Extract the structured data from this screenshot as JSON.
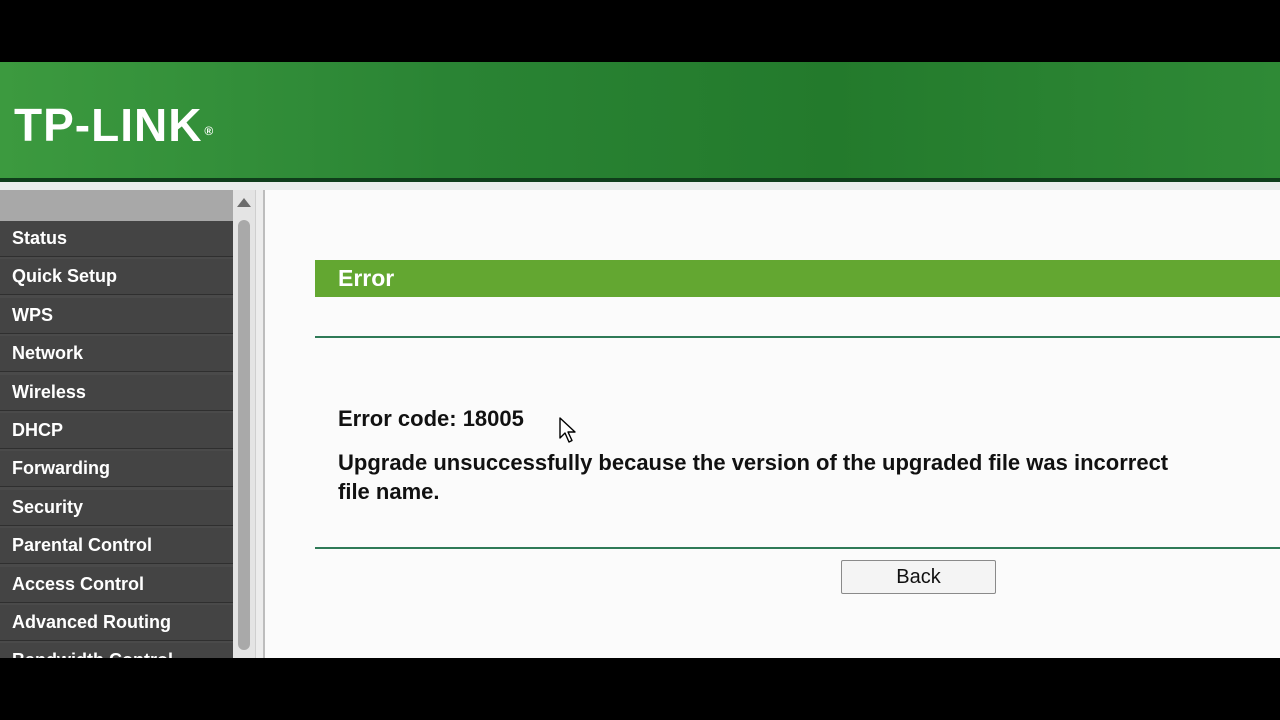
{
  "header": {
    "logo_text": "TP-LINK",
    "registered_mark": "®"
  },
  "sidebar": {
    "items": [
      {
        "label": "Status"
      },
      {
        "label": "Quick Setup"
      },
      {
        "label": "WPS"
      },
      {
        "label": "Network"
      },
      {
        "label": "Wireless"
      },
      {
        "label": "DHCP"
      },
      {
        "label": "Forwarding"
      },
      {
        "label": "Security"
      },
      {
        "label": "Parental Control"
      },
      {
        "label": "Access Control"
      },
      {
        "label": "Advanced Routing"
      },
      {
        "label": "Bandwidth Control"
      }
    ]
  },
  "main": {
    "title": "Error",
    "error_code": "Error code: 18005",
    "message": "Upgrade unsuccessfully because the version of the upgraded file was incorrect\nfile name.",
    "back_label": "Back"
  },
  "colors": {
    "header_green": "#2a8434",
    "title_bar_green": "#63a731",
    "sidebar_bg": "#444444"
  }
}
